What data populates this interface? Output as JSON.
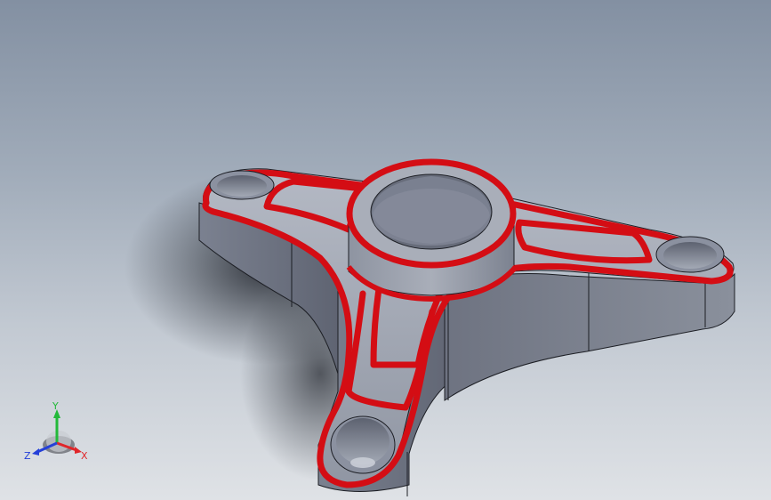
{
  "viewport": {
    "background_top": "#8390a2",
    "background_bottom": "#dfe2e6"
  },
  "model": {
    "body_color": "#6f7482",
    "top_face_color": "#a0a6b3",
    "highlight_color": "#d40d14",
    "edge_color": "#1c1e24"
  },
  "triad": {
    "x_label": "X",
    "y_label": "Y",
    "z_label": "Z",
    "x_color": "#e0262a",
    "y_color": "#23b93a",
    "z_color": "#2440d8"
  }
}
